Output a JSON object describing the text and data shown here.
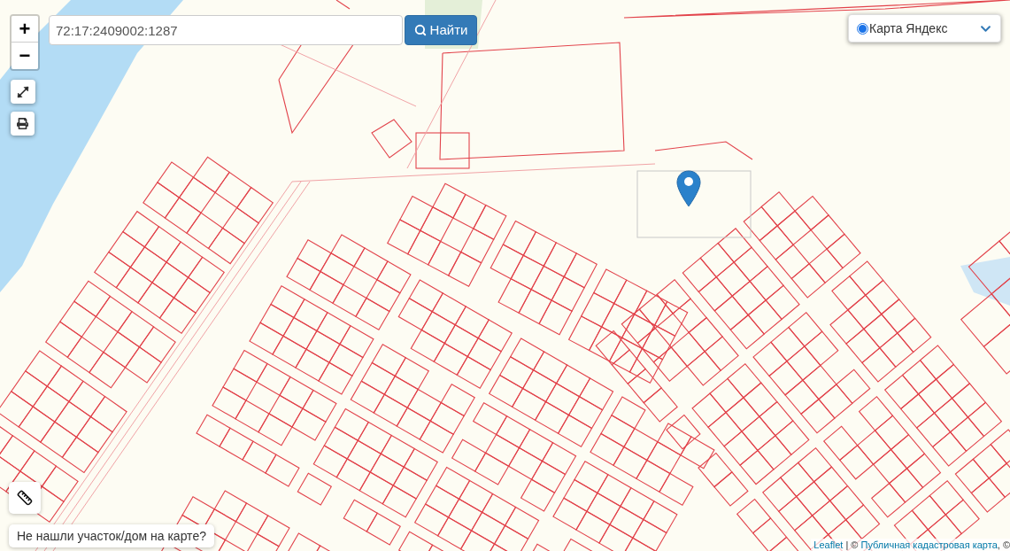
{
  "zoom_controls": {
    "zoom_in": "+",
    "zoom_out": "−"
  },
  "search": {
    "value": "72:17:2409002:1287",
    "button": "Найти"
  },
  "layer_selector": {
    "label": "Карта Яндекс",
    "selected": true
  },
  "help_button": "Не нашли участок/дом на карте?",
  "attribution": {
    "link_1": "Leaflet",
    "separator": " | © ",
    "link_2": "Публичная кадастровая карта",
    "tail": ", ©"
  }
}
